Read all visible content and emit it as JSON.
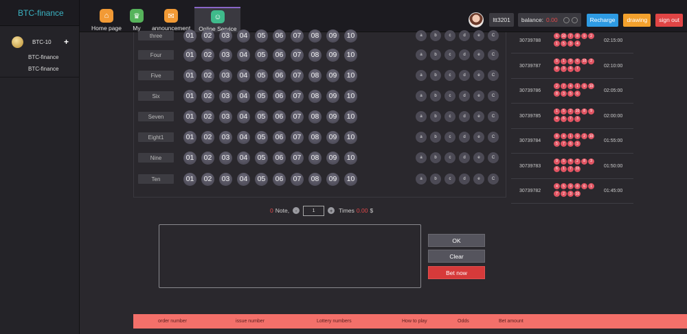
{
  "brand": "BTC-finance",
  "nav": [
    {
      "label": "Home page",
      "icon": "home-icon",
      "symbol": "⌂",
      "color": "orange"
    },
    {
      "label": "My",
      "icon": "crown-icon",
      "symbol": "♛",
      "color": "green"
    },
    {
      "label": "announcement",
      "icon": "message-icon",
      "symbol": "✉",
      "color": "orange"
    },
    {
      "label": "Online Service",
      "icon": "user-service-icon",
      "symbol": "☺",
      "color": "teal",
      "active": true
    }
  ],
  "user": {
    "name": "ltt3201",
    "balance_label": "balance:",
    "balance_value": "0.00"
  },
  "header_buttons": {
    "recharge": "Recharge",
    "drawing": "drawing",
    "signout": "sign out"
  },
  "colors": {
    "accent_purple": "#8a66c9",
    "recharge": "#2e9be3",
    "drawing": "#f3a12d",
    "signout": "#e04545",
    "brand": "#3bb4c4",
    "table_head": "#f3706a"
  },
  "sidebar": {
    "game": "BTC-10",
    "plus": "+",
    "links": [
      "BTC-finance",
      "BTC-finance"
    ]
  },
  "rows": [
    {
      "label": "three"
    },
    {
      "label": "Four"
    },
    {
      "label": "Five"
    },
    {
      "label": "Six"
    },
    {
      "label": "Seven"
    },
    {
      "label": "Eight1"
    },
    {
      "label": "Nine"
    },
    {
      "label": "Ten"
    }
  ],
  "numbers": [
    "01",
    "02",
    "03",
    "04",
    "05",
    "06",
    "07",
    "08",
    "09",
    "10"
  ],
  "quick_picks": [
    "a",
    "b",
    "c",
    "d",
    "e",
    "C"
  ],
  "note": {
    "count": "0",
    "note_label": "Note,",
    "minus": "-",
    "quantity": "1",
    "plus": "+",
    "times_label": "Times",
    "amount": "0.00",
    "currency": "$"
  },
  "actions": {
    "ok": "OK",
    "clear": "Clear",
    "bet_now": "Bet now"
  },
  "results": [
    {
      "issue": "30739788",
      "time": "02:15:00",
      "balls": [
        "6",
        "10",
        "7",
        "8",
        "9",
        "2",
        "1",
        "5",
        "3",
        "4"
      ]
    },
    {
      "issue": "30739787",
      "time": "02:10:00",
      "balls": [
        "5",
        "1",
        "9",
        "6",
        "10",
        "2",
        "8",
        "3",
        "4",
        "7"
      ]
    },
    {
      "issue": "30739786",
      "time": "02:05:00",
      "balls": [
        "2",
        "7",
        "4",
        "1",
        "9",
        "10",
        "8",
        "3",
        "5",
        "6"
      ]
    },
    {
      "issue": "30739785",
      "time": "02:00:00",
      "balls": [
        "1",
        "5",
        "2",
        "10",
        "8",
        "9",
        "4",
        "6",
        "7",
        "3"
      ]
    },
    {
      "issue": "30739784",
      "time": "01:55:00",
      "balls": [
        "8",
        "4",
        "1",
        "9",
        "2",
        "10",
        "5",
        "7",
        "6",
        "3"
      ]
    },
    {
      "issue": "30739783",
      "time": "01:50:00",
      "balls": [
        "9",
        "5",
        "4",
        "2",
        "8",
        "3",
        "6",
        "1",
        "7",
        "10"
      ]
    },
    {
      "issue": "30739782",
      "time": "01:45:00",
      "balls": [
        "4",
        "5",
        "9",
        "8",
        "6",
        "1",
        "7",
        "2",
        "3",
        "10"
      ]
    }
  ],
  "table_headers": [
    "order number",
    "issue number",
    "Lottery numbers",
    "How to play",
    "Odds",
    "Bet amount"
  ]
}
